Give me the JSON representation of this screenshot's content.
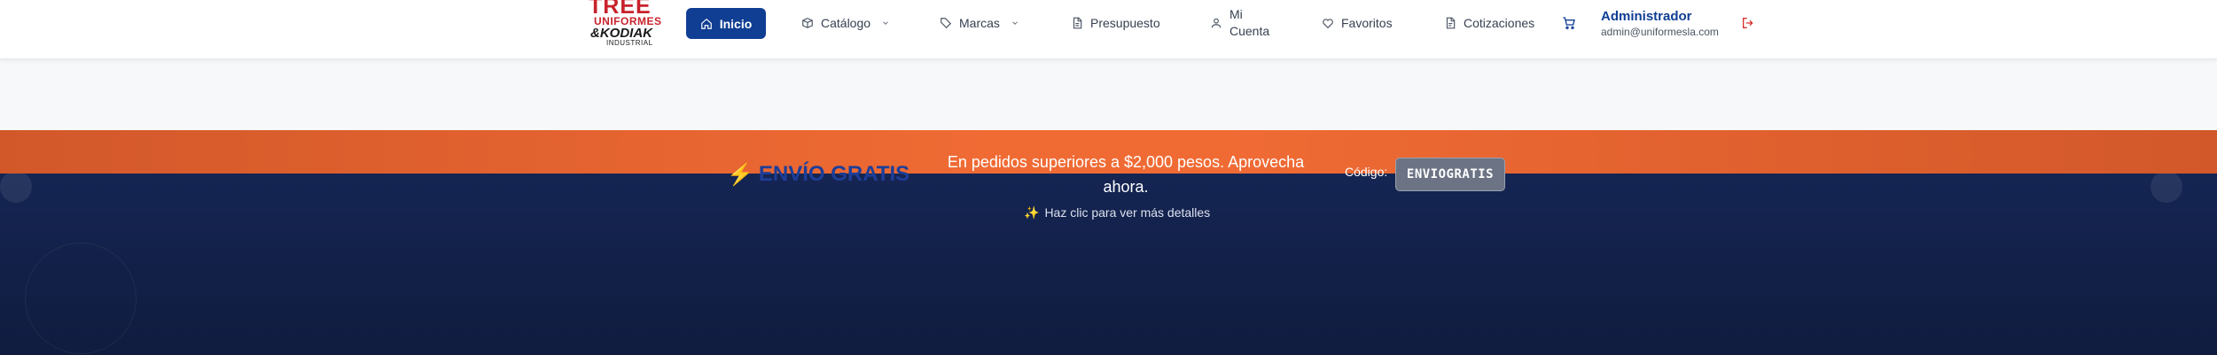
{
  "logo": {
    "line1": "TREE",
    "line2": "UNIFORMES",
    "line3": "&KODIAK",
    "line4": "INDUSTRIAL"
  },
  "nav": {
    "inicio": "Inicio",
    "catalogo": "Catálogo",
    "marcas": "Marcas",
    "presupuesto": "Presupuesto",
    "cuenta_1": "Mi",
    "cuenta_2": "Cuenta",
    "favoritos": "Favoritos",
    "cotizaciones": "Cotizaciones"
  },
  "user": {
    "name": "Administrador",
    "email": "admin@uniformesla.com"
  },
  "promo": {
    "title": "ENVÍO GRATIS",
    "text": "En pedidos superiores a $2,000 pesos. Aprovecha ahora.",
    "hint": "Haz clic para ver más detalles",
    "code_label": "Código:",
    "code": "ENVIOGRATIS"
  },
  "colors": {
    "primary": "#0f3e93",
    "promo_orange": "#f06b34",
    "hero_navy": "#152553",
    "danger": "#d92d2d"
  },
  "icons": {
    "inicio": "home-icon",
    "catalogo": "box-icon",
    "marcas": "tag-icon",
    "presupuesto": "document-icon",
    "cuenta": "user-icon",
    "favoritos": "heart-icon",
    "cotizaciones": "file-text-icon",
    "cart": "cart-icon",
    "logout": "logout-icon"
  }
}
